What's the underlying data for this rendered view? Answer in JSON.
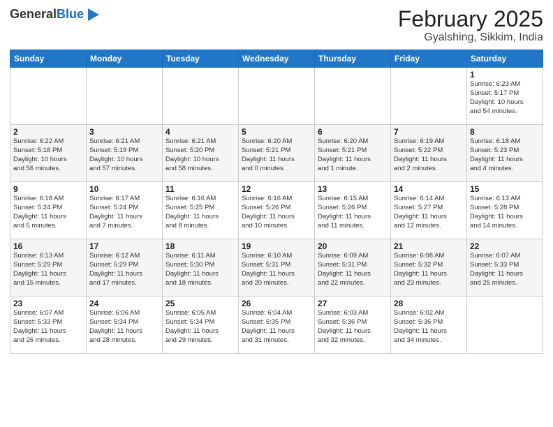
{
  "header": {
    "logo_general": "General",
    "logo_blue": "Blue",
    "month": "February 2025",
    "location": "Gyalshing, Sikkim, India"
  },
  "weekdays": [
    "Sunday",
    "Monday",
    "Tuesday",
    "Wednesday",
    "Thursday",
    "Friday",
    "Saturday"
  ],
  "weeks": [
    [
      {
        "day": "",
        "info": ""
      },
      {
        "day": "",
        "info": ""
      },
      {
        "day": "",
        "info": ""
      },
      {
        "day": "",
        "info": ""
      },
      {
        "day": "",
        "info": ""
      },
      {
        "day": "",
        "info": ""
      },
      {
        "day": "1",
        "info": "Sunrise: 6:23 AM\nSunset: 5:17 PM\nDaylight: 10 hours\nand 54 minutes."
      }
    ],
    [
      {
        "day": "2",
        "info": "Sunrise: 6:22 AM\nSunset: 5:18 PM\nDaylight: 10 hours\nand 56 minutes."
      },
      {
        "day": "3",
        "info": "Sunrise: 6:21 AM\nSunset: 5:19 PM\nDaylight: 10 hours\nand 57 minutes."
      },
      {
        "day": "4",
        "info": "Sunrise: 6:21 AM\nSunset: 5:20 PM\nDaylight: 10 hours\nand 58 minutes."
      },
      {
        "day": "5",
        "info": "Sunrise: 6:20 AM\nSunset: 5:21 PM\nDaylight: 11 hours\nand 0 minutes."
      },
      {
        "day": "6",
        "info": "Sunrise: 6:20 AM\nSunset: 5:21 PM\nDaylight: 11 hours\nand 1 minute."
      },
      {
        "day": "7",
        "info": "Sunrise: 6:19 AM\nSunset: 5:22 PM\nDaylight: 11 hours\nand 2 minutes."
      },
      {
        "day": "8",
        "info": "Sunrise: 6:18 AM\nSunset: 5:23 PM\nDaylight: 11 hours\nand 4 minutes."
      }
    ],
    [
      {
        "day": "9",
        "info": "Sunrise: 6:18 AM\nSunset: 5:24 PM\nDaylight: 11 hours\nand 5 minutes."
      },
      {
        "day": "10",
        "info": "Sunrise: 6:17 AM\nSunset: 5:24 PM\nDaylight: 11 hours\nand 7 minutes."
      },
      {
        "day": "11",
        "info": "Sunrise: 6:16 AM\nSunset: 5:25 PM\nDaylight: 11 hours\nand 8 minutes."
      },
      {
        "day": "12",
        "info": "Sunrise: 6:16 AM\nSunset: 5:26 PM\nDaylight: 11 hours\nand 10 minutes."
      },
      {
        "day": "13",
        "info": "Sunrise: 6:15 AM\nSunset: 5:26 PM\nDaylight: 11 hours\nand 11 minutes."
      },
      {
        "day": "14",
        "info": "Sunrise: 6:14 AM\nSunset: 5:27 PM\nDaylight: 11 hours\nand 12 minutes."
      },
      {
        "day": "15",
        "info": "Sunrise: 6:13 AM\nSunset: 5:28 PM\nDaylight: 11 hours\nand 14 minutes."
      }
    ],
    [
      {
        "day": "16",
        "info": "Sunrise: 6:13 AM\nSunset: 5:29 PM\nDaylight: 11 hours\nand 15 minutes."
      },
      {
        "day": "17",
        "info": "Sunrise: 6:12 AM\nSunset: 5:29 PM\nDaylight: 11 hours\nand 17 minutes."
      },
      {
        "day": "18",
        "info": "Sunrise: 6:11 AM\nSunset: 5:30 PM\nDaylight: 11 hours\nand 18 minutes."
      },
      {
        "day": "19",
        "info": "Sunrise: 6:10 AM\nSunset: 5:31 PM\nDaylight: 11 hours\nand 20 minutes."
      },
      {
        "day": "20",
        "info": "Sunrise: 6:09 AM\nSunset: 5:31 PM\nDaylight: 11 hours\nand 22 minutes."
      },
      {
        "day": "21",
        "info": "Sunrise: 6:08 AM\nSunset: 5:32 PM\nDaylight: 11 hours\nand 23 minutes."
      },
      {
        "day": "22",
        "info": "Sunrise: 6:07 AM\nSunset: 5:33 PM\nDaylight: 11 hours\nand 25 minutes."
      }
    ],
    [
      {
        "day": "23",
        "info": "Sunrise: 6:07 AM\nSunset: 5:33 PM\nDaylight: 11 hours\nand 26 minutes."
      },
      {
        "day": "24",
        "info": "Sunrise: 6:06 AM\nSunset: 5:34 PM\nDaylight: 11 hours\nand 28 minutes."
      },
      {
        "day": "25",
        "info": "Sunrise: 6:05 AM\nSunset: 5:34 PM\nDaylight: 11 hours\nand 29 minutes."
      },
      {
        "day": "26",
        "info": "Sunrise: 6:04 AM\nSunset: 5:35 PM\nDaylight: 11 hours\nand 31 minutes."
      },
      {
        "day": "27",
        "info": "Sunrise: 6:03 AM\nSunset: 5:36 PM\nDaylight: 11 hours\nand 32 minutes."
      },
      {
        "day": "28",
        "info": "Sunrise: 6:02 AM\nSunset: 5:36 PM\nDaylight: 11 hours\nand 34 minutes."
      },
      {
        "day": "",
        "info": ""
      }
    ]
  ]
}
